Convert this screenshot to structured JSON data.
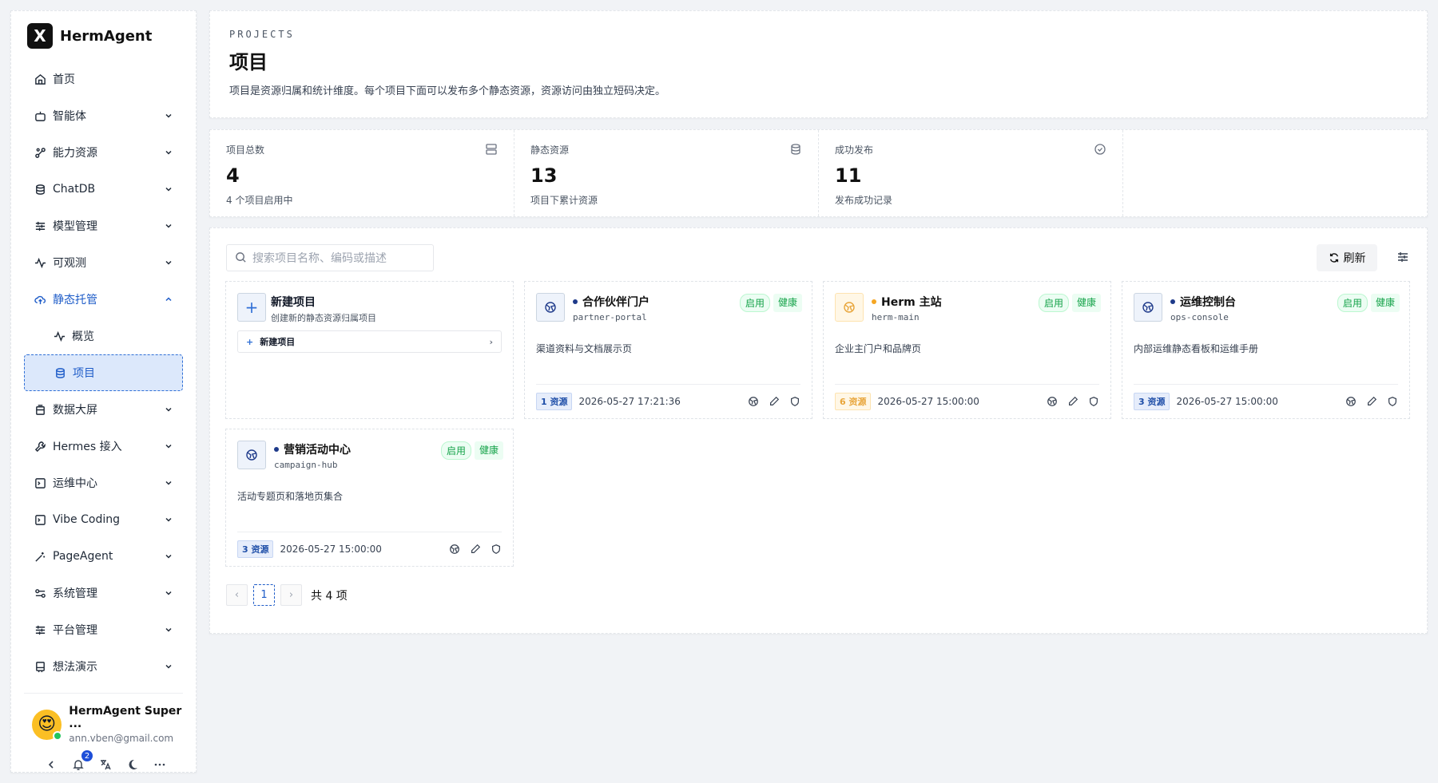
{
  "app": {
    "logo": "X",
    "name": "HermAgent"
  },
  "sidebar": {
    "items": [
      {
        "label": "首页",
        "icon": "home-icon"
      },
      {
        "label": "智能体",
        "icon": "robot-icon"
      },
      {
        "label": "能力资源",
        "icon": "nodes-icon"
      },
      {
        "label": "ChatDB",
        "icon": "database-icon"
      },
      {
        "label": "模型管理",
        "icon": "sliders-icon"
      },
      {
        "label": "可观测",
        "icon": "activity-icon"
      },
      {
        "label": "静态托管",
        "icon": "cloud-upload-icon"
      },
      {
        "label": "概览",
        "icon": "activity-icon"
      },
      {
        "label": "项目",
        "icon": "database-icon"
      },
      {
        "label": "数据大屏",
        "icon": "layers-icon"
      },
      {
        "label": "Hermes 接入",
        "icon": "wrench-icon"
      },
      {
        "label": "运维中心",
        "icon": "terminal-icon"
      },
      {
        "label": "Vibe Coding",
        "icon": "terminal-icon"
      },
      {
        "label": "PageAgent",
        "icon": "magic-icon"
      },
      {
        "label": "系统管理",
        "icon": "toggles-icon"
      },
      {
        "label": "平台管理",
        "icon": "sliders-icon"
      },
      {
        "label": "想法演示",
        "icon": "bin-icon"
      }
    ]
  },
  "user": {
    "name": "HermAgent Super ...",
    "email": "ann.vben@gmail.com",
    "avatar": "😍",
    "notifications": "2"
  },
  "header": {
    "kicker": "PROJECTS",
    "title": "项目",
    "description": "项目是资源归属和统计维度。每个项目下面可以发布多个静态资源，资源访问由独立短码决定。"
  },
  "stats": [
    {
      "label": "项目总数",
      "value": "4",
      "sub": "4 个项目启用中"
    },
    {
      "label": "静态资源",
      "value": "13",
      "sub": "项目下累计资源"
    },
    {
      "label": "成功发布",
      "value": "11",
      "sub": "发布成功记录"
    }
  ],
  "toolbar": {
    "search_placeholder": "搜索项目名称、编码或描述",
    "refresh_label": "刷新"
  },
  "new_card": {
    "title": "新建项目",
    "desc": "创建新的静态资源归属项目",
    "button": "新建项目"
  },
  "projects": [
    {
      "name": "合作伙伴门户",
      "code": "partner-portal",
      "desc": "渠道资料与文档展示页",
      "status": "启用",
      "health": "健康",
      "resources": "1 资源",
      "time": "2026-05-27 17:21:36"
    },
    {
      "name": "Herm 主站",
      "code": "herm-main",
      "desc": "企业主门户和品牌页",
      "status": "启用",
      "health": "健康",
      "resources": "6 资源",
      "time": "2026-05-27 15:00:00"
    },
    {
      "name": "运维控制台",
      "code": "ops-console",
      "desc": "内部运维静态看板和运维手册",
      "status": "启用",
      "health": "健康",
      "resources": "3 资源",
      "time": "2026-05-27 15:00:00"
    },
    {
      "name": "营销活动中心",
      "code": "campaign-hub",
      "desc": "活动专题页和落地页集合",
      "status": "启用",
      "health": "健康",
      "resources": "3 资源",
      "time": "2026-05-27 15:00:00"
    }
  ],
  "pagination": {
    "current": "1",
    "total": "共 4 项"
  }
}
